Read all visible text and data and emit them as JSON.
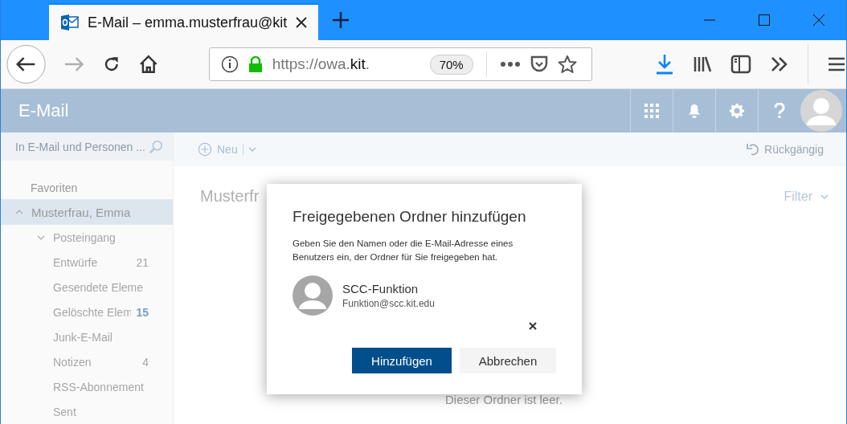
{
  "browser": {
    "tab": {
      "title": "E-Mail – emma.musterfrau@kit"
    },
    "url": {
      "prefix": "https://owa.",
      "domain": "kit",
      "suffix": "."
    },
    "zoom": "70%"
  },
  "header": {
    "title": "E-Mail"
  },
  "search": {
    "placeholder": "In E-Mail und Personen ..."
  },
  "toolbar": {
    "new": "Neu",
    "undo": {
      "label": "Rückgängig",
      "disabled": true
    }
  },
  "sidebar": {
    "section": "Favoriten",
    "account": {
      "label": "Musterfrau, Emma",
      "expanded": true,
      "selected": true,
      "children": [
        {
          "label": "Posteingang",
          "expanded": true,
          "selected": false
        },
        {
          "label": "Entwürfe",
          "count": "21",
          "unread": false,
          "selected": false
        },
        {
          "label": "Gesendete Eleme",
          "selected": false
        },
        {
          "label": "Gelöschte Elem",
          "count": "15",
          "unread": true,
          "selected": false
        },
        {
          "label": "Junk-E-Mail",
          "selected": false
        },
        {
          "label": "Notizen",
          "count": "4",
          "unread": false,
          "selected": false
        },
        {
          "label": "RSS-Abonnement",
          "selected": false
        },
        {
          "label": "Sent",
          "selected": false
        }
      ]
    }
  },
  "main": {
    "folder_title": "Musterfr",
    "filter": "Filter",
    "empty": "Dieser Ordner ist leer."
  },
  "dialog": {
    "title": "Freigegebenen Ordner hinzufügen",
    "description": "Geben Sie den Namen oder die E-Mail-Adresse eines Benutzers ein, der Ordner für Sie freigegeben hat.",
    "person": {
      "name": "SCC-Funktion",
      "email": "Funktion@scc.kit.edu"
    },
    "buttons": [
      {
        "label": "Hinzufügen",
        "kind": "primary"
      },
      {
        "label": "Abbrechen",
        "kind": "secondary"
      }
    ]
  }
}
